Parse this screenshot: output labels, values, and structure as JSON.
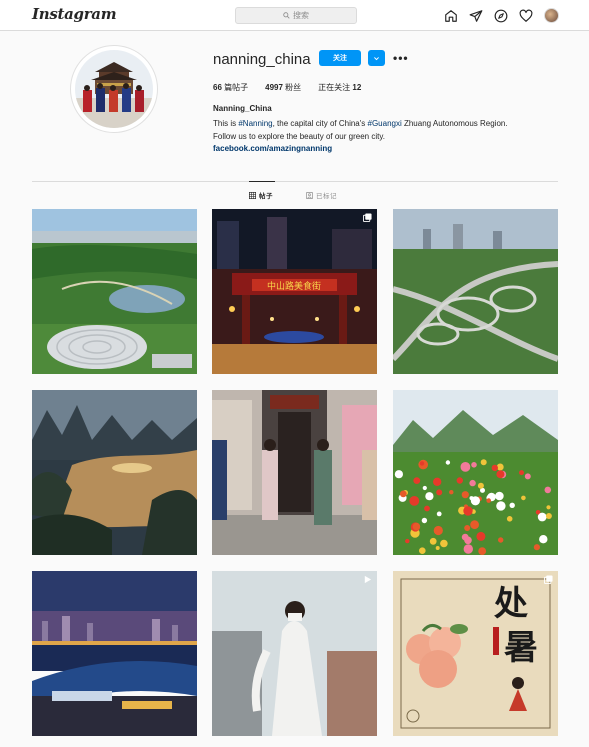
{
  "nav": {
    "logo": "Instagram",
    "search_placeholder": "搜索",
    "icons": [
      "home-icon",
      "send-icon",
      "explore-icon",
      "heart-icon",
      "profile-avatar"
    ]
  },
  "profile": {
    "username": "nanning_china",
    "follow_label": "关注",
    "more_label": "•••",
    "stats": [
      {
        "count": "66",
        "label": "篇帖子"
      },
      {
        "count": "4997",
        "label": "粉丝"
      },
      {
        "label": "正在关注",
        "count": "12"
      }
    ],
    "full_name": "Nanning_China",
    "bio_line1_a": "This is ",
    "bio_tag1": "#Nanning",
    "bio_line1_b": ", the capital city of China's ",
    "bio_tag2": "#Guangxi",
    "bio_line1_c": " Zhuang Autonomous Region.",
    "bio_line2": "Follow us to explore the beauty of our green city.",
    "link": "facebook.com/amazingnanning"
  },
  "tabs": {
    "posts": "帖子",
    "tagged": "已标记"
  },
  "posts": [
    {
      "subject": "green park with dome stadium",
      "multi": false
    },
    {
      "subject": "night pedestrian street",
      "multi": true,
      "sign_text": "中山路美食街"
    },
    {
      "subject": "highway interchange",
      "multi": false
    },
    {
      "subject": "karst river at dusk",
      "multi": false
    },
    {
      "subject": "women in qipao dancing",
      "multi": false
    },
    {
      "subject": "flower field with mountains",
      "multi": false
    },
    {
      "subject": "city skyline at night",
      "multi": false
    },
    {
      "subject": "woman in white hanfu",
      "multi": false,
      "video": true
    },
    {
      "subject": "处暑 illustration",
      "multi": true,
      "text_top": "处",
      "text_bottom": "暑"
    }
  ],
  "colors": {
    "accent": "#0095f6",
    "link": "#00376b",
    "text": "#262626",
    "muted": "#8e8e8e",
    "border": "#dbdbdb"
  }
}
